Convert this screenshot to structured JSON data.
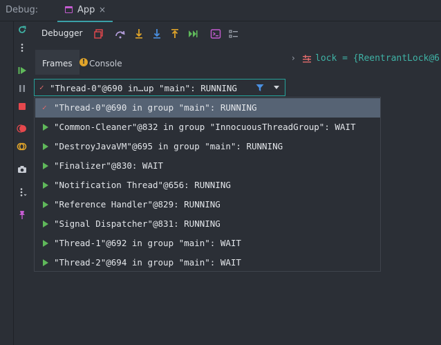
{
  "titlebar": {
    "debug_label": "Debug:",
    "app_tab_label": "App",
    "close_symbol": "×"
  },
  "gutter_icons": [
    "rerun-icon",
    "more-icon",
    "resume-icon",
    "pause-icon",
    "stop-icon",
    "view-breakpoints-icon",
    "mute-breakpoints-icon",
    "camera-icon",
    "more-settings-icon",
    "pin-icon"
  ],
  "toolbar": {
    "debugger_label": "Debugger",
    "icons": [
      "restore-layout-icon",
      "step-over-icon",
      "step-into-icon",
      "force-step-into-icon",
      "step-out-icon",
      "run-to-cursor-icon",
      "evaluate-expression-icon",
      "trace-icon"
    ]
  },
  "tabs": {
    "frames_label": "Frames",
    "console_label": "Console",
    "console_warning": "!"
  },
  "variables": {
    "chevron": "›",
    "text": "lock = {ReentrantLock@6"
  },
  "thread_combo": {
    "check": "✓",
    "value": "\"Thread-0\"@690 in…up \"main\": RUNNING"
  },
  "threads": [
    {
      "label": "\"Thread-0\"@690 in group \"main\": RUNNING",
      "selected": true
    },
    {
      "label": "\"Common-Cleaner\"@832 in group \"InnocuousThreadGroup\": WAIT",
      "selected": false
    },
    {
      "label": "\"DestroyJavaVM\"@695 in group \"main\": RUNNING",
      "selected": false
    },
    {
      "label": "\"Finalizer\"@830: WAIT",
      "selected": false
    },
    {
      "label": "\"Notification Thread\"@656: RUNNING",
      "selected": false
    },
    {
      "label": "\"Reference Handler\"@829: RUNNING",
      "selected": false
    },
    {
      "label": "\"Signal Dispatcher\"@831: RUNNING",
      "selected": false
    },
    {
      "label": "\"Thread-1\"@692 in group \"main\": WAIT",
      "selected": false
    },
    {
      "label": "\"Thread-2\"@694 in group \"main\": WAIT",
      "selected": false
    }
  ],
  "colors": {
    "accent": "#26a39b",
    "selection": "#566374",
    "running_green": "#5fb85a",
    "check_red": "#e26b6b",
    "variable_teal": "#3fb2a5"
  }
}
